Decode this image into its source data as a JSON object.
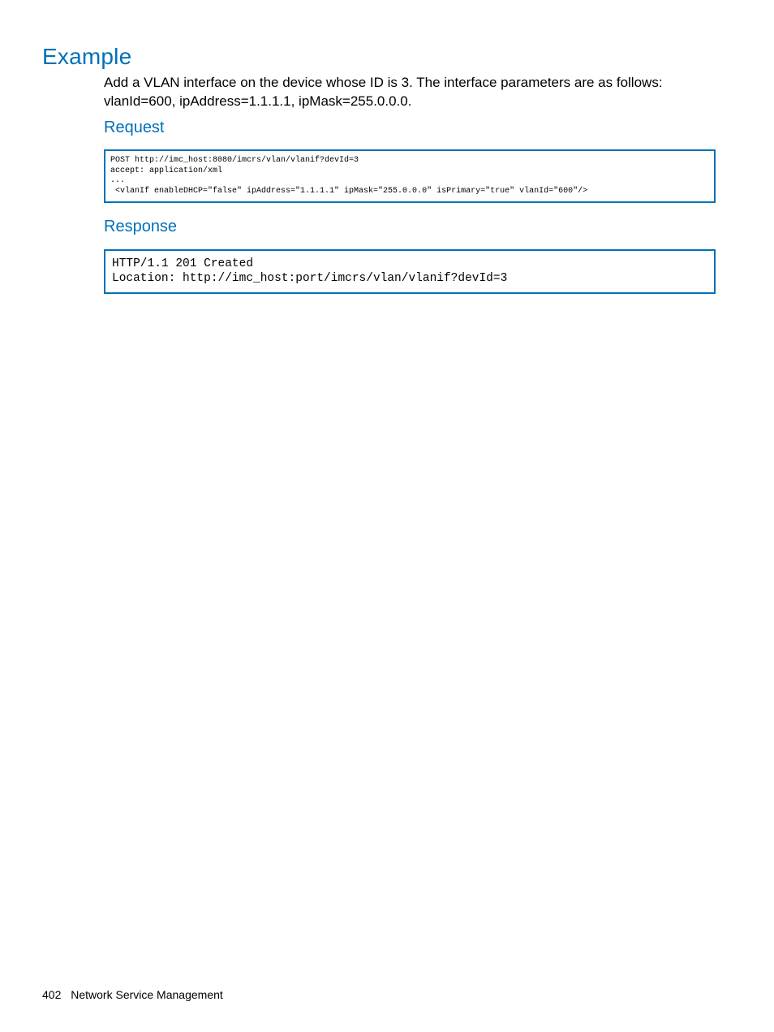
{
  "headings": {
    "example": "Example",
    "request": "Request",
    "response": "Response"
  },
  "intro": "Add a VLAN interface on the device whose ID is 3. The interface parameters are as follows: vlanId=600, ipAddress=1.1.1.1, ipMask=255.0.0.0.",
  "request_code": "POST http://imc_host:8080/imcrs/vlan/vlanif?devId=3\naccept: application/xml\n...\n <vlanIf enableDHCP=\"false\" ipAddress=\"1.1.1.1\" ipMask=\"255.0.0.0\" isPrimary=\"true\" vlanId=\"600\"/>",
  "response_code": "HTTP/1.1 201 Created\nLocation: http://imc_host:port/imcrs/vlan/vlanif?devId=3",
  "footer": {
    "page_number": "402",
    "section": "Network Service Management"
  }
}
